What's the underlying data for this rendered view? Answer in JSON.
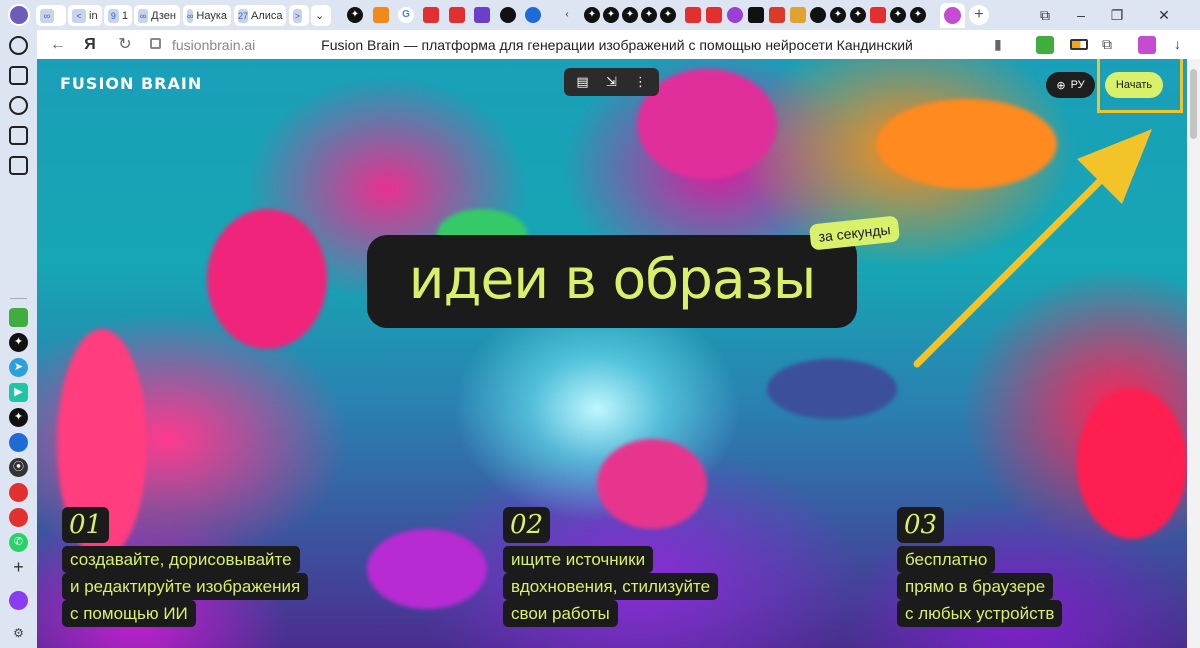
{
  "tabs": {
    "group_items": [
      {
        "icon": "∞",
        "label": ""
      },
      {
        "icon": "<",
        "label": "in"
      },
      {
        "icon": "9",
        "label": "1"
      },
      {
        "icon": "∞",
        "label": "Дзен"
      },
      {
        "icon": "∞",
        "label": "Наука"
      },
      {
        "icon": "27",
        "label": "Алиса"
      },
      {
        "icon": ">",
        "label": ""
      }
    ],
    "new_tab_label": "+"
  },
  "address_bar": {
    "url": "fusionbrain.ai",
    "page_title": "Fusion Brain — платформа для генерации изображений с помощью нейросети Кандинский"
  },
  "site": {
    "logo": "FUSION BRAIN",
    "lang_label": "РУ",
    "start_label": "Начать",
    "hero_text": "идеи в образы",
    "hero_sticker": "за секунды",
    "features": [
      {
        "num": "01",
        "lines": [
          "создавайте, дорисовывайте",
          "и редактируйте изображения",
          "с помощью ИИ"
        ]
      },
      {
        "num": "02",
        "lines": [
          "ищите источники",
          "вдохновения, стилизуйте",
          "свои работы"
        ]
      },
      {
        "num": "03",
        "lines": [
          "бесплатно",
          "прямо в браузере",
          "с любых устройств"
        ]
      }
    ]
  },
  "colors": {
    "accent": "#d9f06b",
    "dark": "#1b1b1b",
    "annotation": "#f2c42a"
  }
}
